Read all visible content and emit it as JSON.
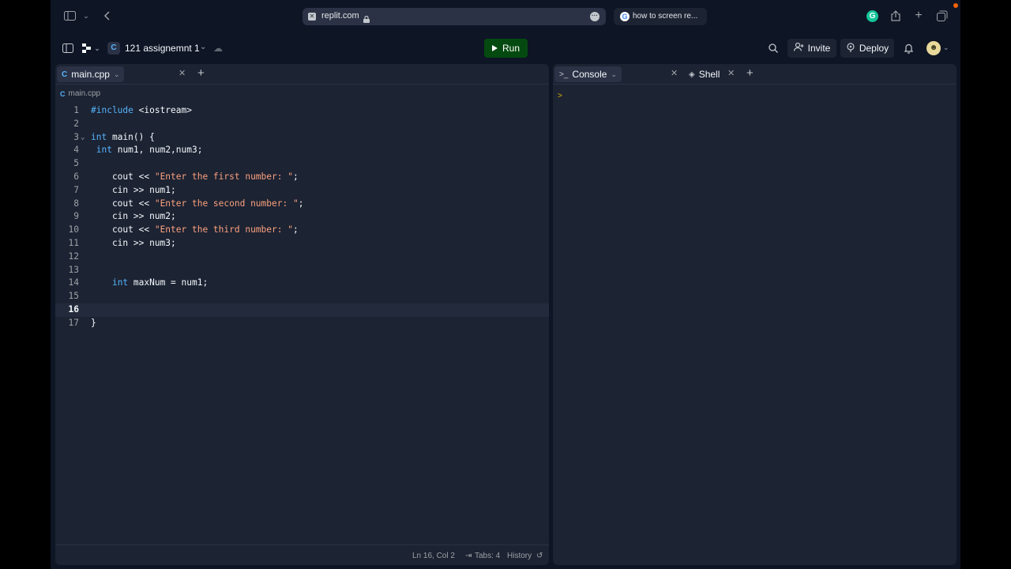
{
  "browser": {
    "url": "replit.com",
    "tab2_title": "how to screen re..."
  },
  "header": {
    "repl_name": "121 assignemnt 1",
    "run_label": "Run",
    "invite_label": "Invite",
    "deploy_label": "Deploy"
  },
  "editor": {
    "tab_label": "main.cpp",
    "breadcrumb": "main.cpp",
    "current_line": 16,
    "lines": [
      {
        "n": "1",
        "text": "#include <iostream>"
      },
      {
        "n": "2",
        "text": ""
      },
      {
        "n": "3",
        "text": "int main() {"
      },
      {
        "n": "4",
        "text": " int num1, num2,num3;"
      },
      {
        "n": "5",
        "text": ""
      },
      {
        "n": "6",
        "text": "    cout << \"Enter the first number: \";"
      },
      {
        "n": "7",
        "text": "    cin >> num1;"
      },
      {
        "n": "8",
        "text": "    cout << \"Enter the second number: \";"
      },
      {
        "n": "9",
        "text": "    cin >> num2;"
      },
      {
        "n": "10",
        "text": "    cout << \"Enter the third number: \";"
      },
      {
        "n": "11",
        "text": "    cin >> num3;"
      },
      {
        "n": "12",
        "text": ""
      },
      {
        "n": "13",
        "text": ""
      },
      {
        "n": "14",
        "text": "    int maxNum = num1;"
      },
      {
        "n": "15",
        "text": ""
      },
      {
        "n": "16",
        "text": ""
      },
      {
        "n": "17",
        "text": "}"
      }
    ]
  },
  "status": {
    "position": "Ln 16, Col 2",
    "tabs": "Tabs: 4",
    "history": "History"
  },
  "console": {
    "tab_console": "Console",
    "tab_shell": "Shell",
    "prompt": ">"
  },
  "colors": {
    "background": "#0e1525",
    "panel": "#1c2333",
    "run_button": "#044a10",
    "keyword": "#56b3fa",
    "string": "#fca17d"
  }
}
